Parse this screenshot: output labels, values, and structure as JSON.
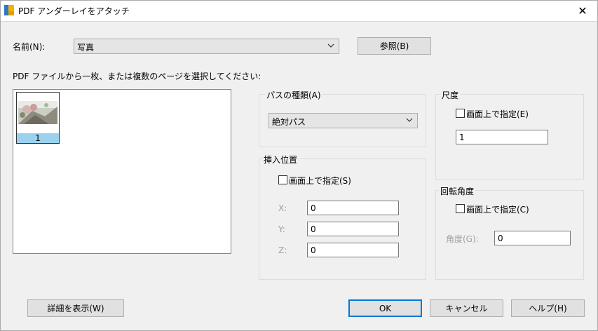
{
  "window": {
    "title": "PDF アンダーレイをアタッチ",
    "close_glyph": "✕"
  },
  "name_row": {
    "label": "名前(N):",
    "value": "写真",
    "browse_label": "参照(B)"
  },
  "page_select": {
    "instruction": "PDF ファイルから一枚、または複数のページを選択してください:",
    "pages": [
      {
        "number": "1",
        "selected": true
      }
    ]
  },
  "path_type": {
    "title": "パスの種類(A)",
    "value": "絶対パス"
  },
  "insertion": {
    "title": "挿入位置",
    "specify_onscreen": "画面上で指定(S)",
    "x_label": "X:",
    "x_value": "0",
    "y_label": "Y:",
    "y_value": "0",
    "z_label": "Z:",
    "z_value": "0"
  },
  "scale": {
    "title": "尺度",
    "specify_onscreen": "画面上で指定(E)",
    "value": "1"
  },
  "rotation": {
    "title": "回転角度",
    "specify_onscreen": "画面上で指定(C)",
    "angle_label": "角度(G):",
    "angle_value": "0"
  },
  "buttons": {
    "details": "詳細を表示(W)",
    "ok": "OK",
    "cancel": "キャンセル",
    "help": "ヘルプ(H)"
  },
  "colors": {
    "accent": "#0078d7",
    "selection": "#99d1ef"
  }
}
